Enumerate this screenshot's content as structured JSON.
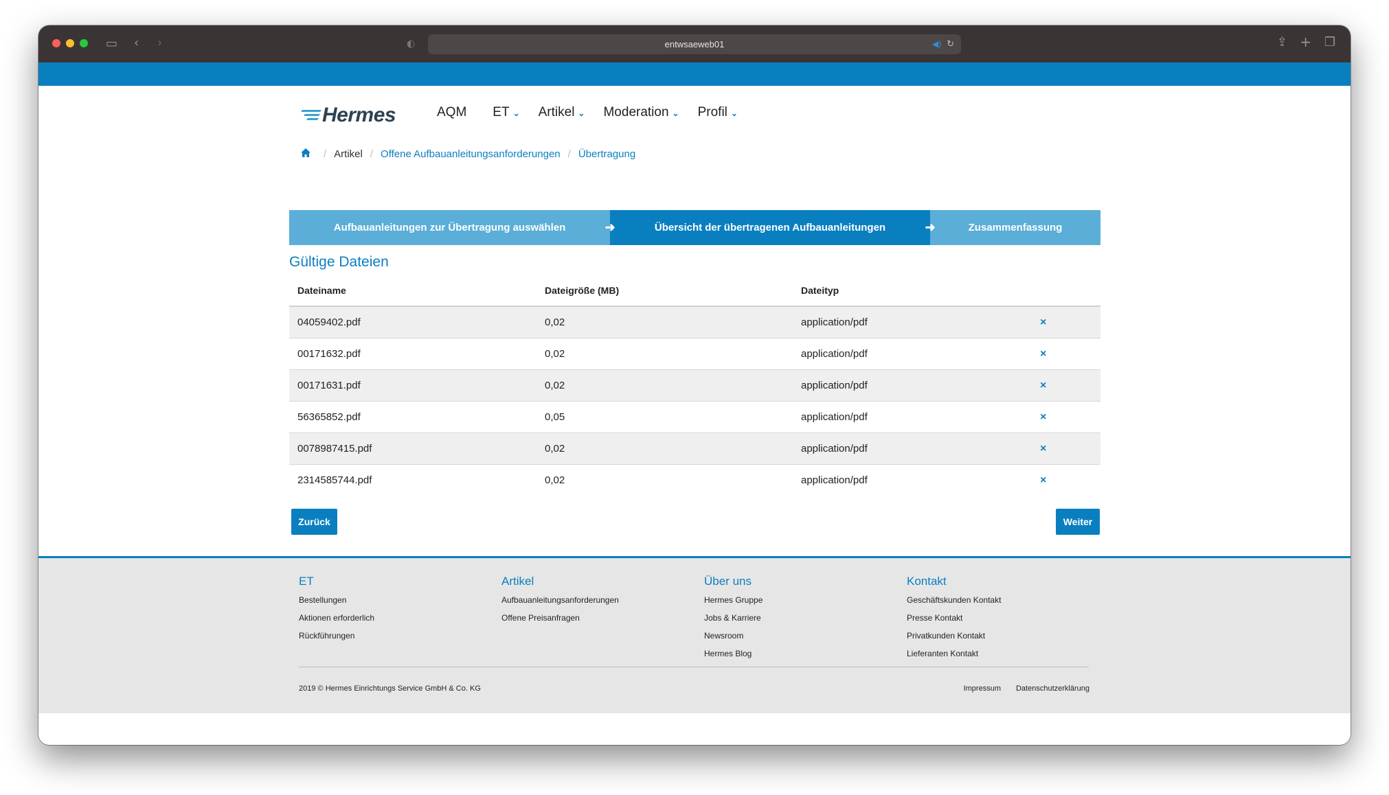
{
  "browser": {
    "url": "entwsaeweb01"
  },
  "header": {
    "logo_text": "Hermes",
    "nav": [
      {
        "label": "AQM",
        "has_dropdown": false
      },
      {
        "label": "ET",
        "has_dropdown": true
      },
      {
        "label": "Artikel",
        "has_dropdown": true
      },
      {
        "label": "Moderation",
        "has_dropdown": true
      },
      {
        "label": "Profil",
        "has_dropdown": true
      }
    ]
  },
  "breadcrumb": {
    "items": [
      "Artikel",
      "Offene Aufbauanleitungsanforderungen",
      "Übertragung"
    ]
  },
  "steps": [
    "Aufbauanleitungen zur Übertragung auswählen",
    "Übersicht der übertragenen Aufbauanleitungen",
    "Zusammenfassung"
  ],
  "section_title": "Gültige Dateien",
  "table": {
    "headers": [
      "Dateiname",
      "Dateigröße (MB)",
      "Dateityp"
    ],
    "rows": [
      {
        "name": "04059402.pdf",
        "size": "0,02",
        "type": "application/pdf"
      },
      {
        "name": "00171632.pdf",
        "size": "0,02",
        "type": "application/pdf"
      },
      {
        "name": "00171631.pdf",
        "size": "0,02",
        "type": "application/pdf"
      },
      {
        "name": "56365852.pdf",
        "size": "0,05",
        "type": "application/pdf"
      },
      {
        "name": "0078987415.pdf",
        "size": "0,02",
        "type": "application/pdf"
      },
      {
        "name": "2314585744.pdf",
        "size": "0,02",
        "type": "application/pdf"
      }
    ],
    "remove_icon": "×"
  },
  "buttons": {
    "back": "Zurück",
    "next": "Weiter"
  },
  "footer": {
    "columns": [
      {
        "title": "ET",
        "links": [
          "Bestellungen",
          "Aktionen erforderlich",
          "Rückführungen"
        ]
      },
      {
        "title": "Artikel",
        "links": [
          "Aufbauanleitungsanforderungen",
          "Offene Preisanfragen"
        ]
      },
      {
        "title": "Über uns",
        "links": [
          "Hermes Gruppe",
          "Jobs & Karriere",
          "Newsroom",
          "Hermes Blog"
        ]
      },
      {
        "title": "Kontakt",
        "links": [
          "Geschäftskunden Kontakt",
          "Presse Kontakt",
          "Privatkunden Kontakt",
          "Lieferanten Kontakt"
        ]
      }
    ],
    "copyright": "2019 © Hermes Einrichtungs Service GmbH & Co. KG",
    "bottom_links": [
      "Impressum",
      "Datenschutzerklärung"
    ]
  },
  "colors": {
    "brand_blue": "#0a7fc0",
    "step_light": "#5aaed8"
  }
}
